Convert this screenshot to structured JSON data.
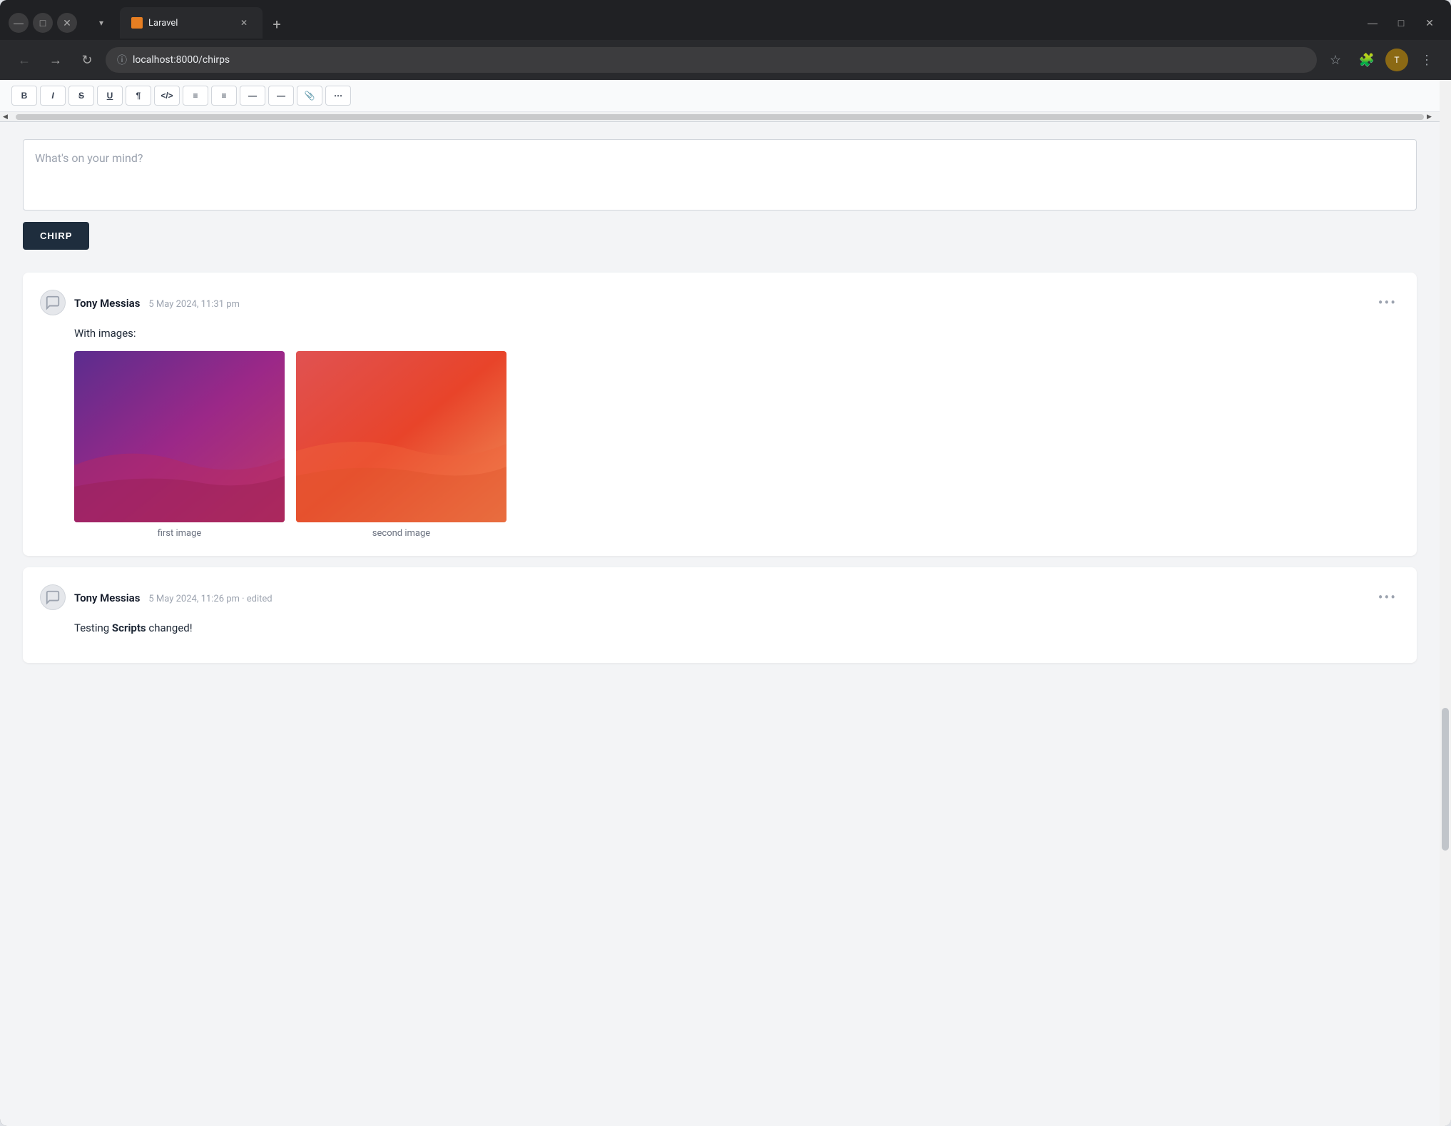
{
  "browser": {
    "tab_title": "Laravel",
    "tab_favicon": "L",
    "url": "localhost:8000/chirps",
    "window_controls": {
      "minimize": "—",
      "maximize": "□",
      "close": "✕"
    }
  },
  "toolbar": {
    "buttons": [
      "B",
      "I",
      "S",
      "U",
      "¶",
      "≈",
      "≡",
      "≡",
      "—",
      "—",
      "📎"
    ],
    "scroll_left": "◀",
    "scroll_right": "▶"
  },
  "compose": {
    "placeholder": "What's on your mind?",
    "button_label": "CHIRP"
  },
  "chirps": [
    {
      "id": 1,
      "author": "Tony Messias",
      "time": "5 May 2024, 11:31 pm",
      "body": "With images:",
      "images": [
        {
          "caption": "first image"
        },
        {
          "caption": "second image"
        }
      ],
      "more": "•••"
    },
    {
      "id": 2,
      "author": "Tony Messias",
      "time": "5 May 2024, 11:26 pm · edited",
      "body_prefix": "Testing ",
      "body_bold": "Scripts",
      "body_suffix": " changed!",
      "more": "•••"
    }
  ],
  "icons": {
    "comment_bubble": "💬",
    "more_options": "•••"
  }
}
